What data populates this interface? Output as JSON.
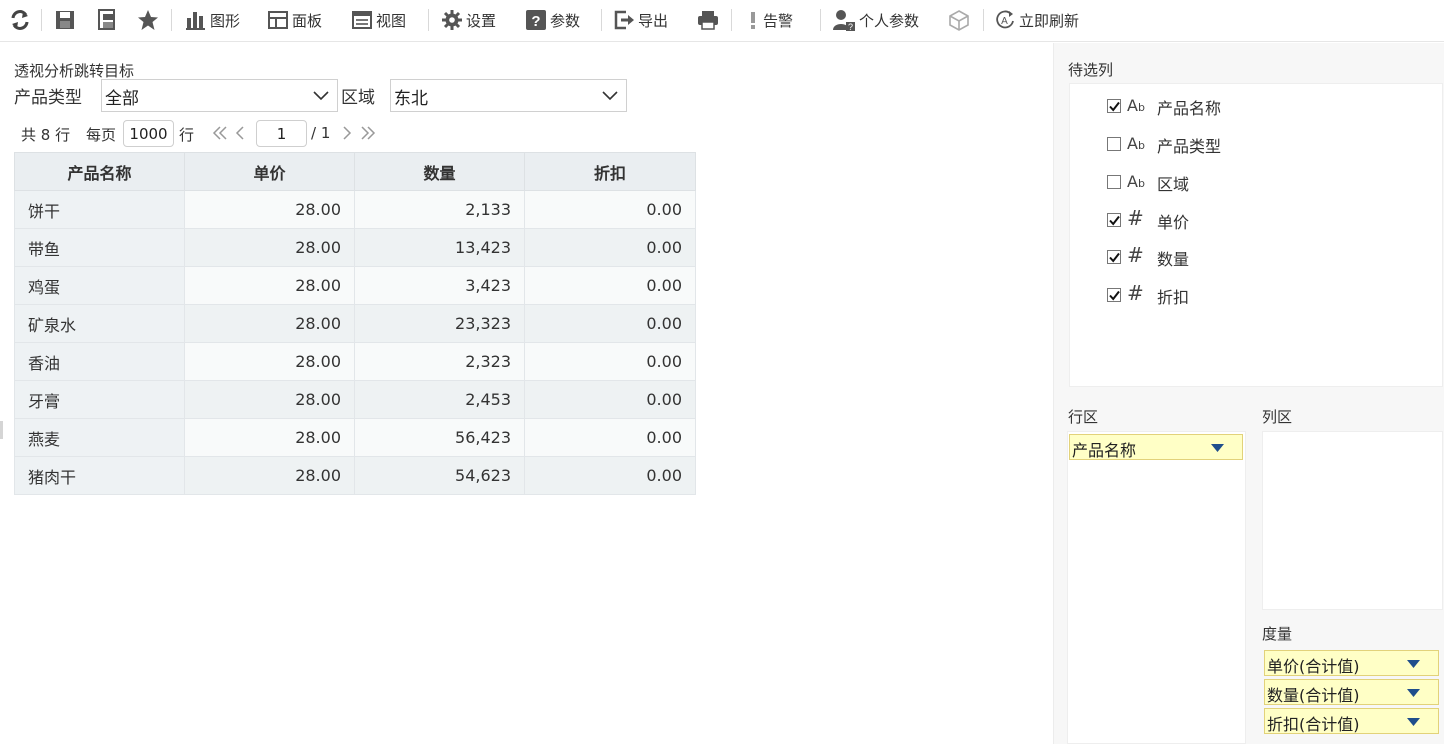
{
  "toolbar": {
    "graph_label": "图形",
    "panel_label": "面板",
    "view_label": "视图",
    "settings_label": "设置",
    "params_label": "参数",
    "export_label": "导出",
    "alarm_label": "告警",
    "personal_params_label": "个人参数",
    "refresh_label": "立即刷新"
  },
  "report": {
    "title": "透视分析跳转目标",
    "filters": [
      {
        "label": "产品类型",
        "value": "全部"
      },
      {
        "label": "区域",
        "value": "东北"
      }
    ]
  },
  "pager": {
    "total": "共 8 行",
    "per_page_label": "每页",
    "per_page_value": "1000",
    "rows_unit": "行",
    "current_page": "1",
    "total_pages": "/ 1"
  },
  "table": {
    "columns": [
      "产品名称",
      "单价",
      "数量",
      "折扣"
    ],
    "rows": [
      [
        "饼干",
        "28.00",
        "2,133",
        "0.00"
      ],
      [
        "带鱼",
        "28.00",
        "13,423",
        "0.00"
      ],
      [
        "鸡蛋",
        "28.00",
        "3,423",
        "0.00"
      ],
      [
        "矿泉水",
        "28.00",
        "23,323",
        "0.00"
      ],
      [
        "香油",
        "28.00",
        "2,323",
        "0.00"
      ],
      [
        "牙膏",
        "28.00",
        "2,453",
        "0.00"
      ],
      [
        "燕麦",
        "28.00",
        "56,423",
        "0.00"
      ],
      [
        "猪肉干",
        "28.00",
        "54,623",
        "0.00"
      ]
    ]
  },
  "panel": {
    "candidates_title": "待选列",
    "fields": [
      {
        "name": "产品名称",
        "type": "text",
        "checked": true
      },
      {
        "name": "产品类型",
        "type": "text",
        "checked": false
      },
      {
        "name": "区域",
        "type": "text",
        "checked": false
      },
      {
        "name": "单价",
        "type": "number",
        "checked": true
      },
      {
        "name": "数量",
        "type": "number",
        "checked": true
      },
      {
        "name": "折扣",
        "type": "number",
        "checked": true
      }
    ],
    "row_zone_title": "行区",
    "row_zone_items": [
      "产品名称"
    ],
    "col_zone_title": "列区",
    "measure_title": "度量",
    "measures": [
      "单价(合计值)",
      "数量(合计值)",
      "折扣(合计值)"
    ]
  },
  "colors": {
    "chip_bg": "#ffffc6",
    "chip_border": "#e2d27a",
    "header_bg": "#eaeef1",
    "icon_dark": "#444444",
    "dropdown_arrow": "#1f4e8c"
  }
}
